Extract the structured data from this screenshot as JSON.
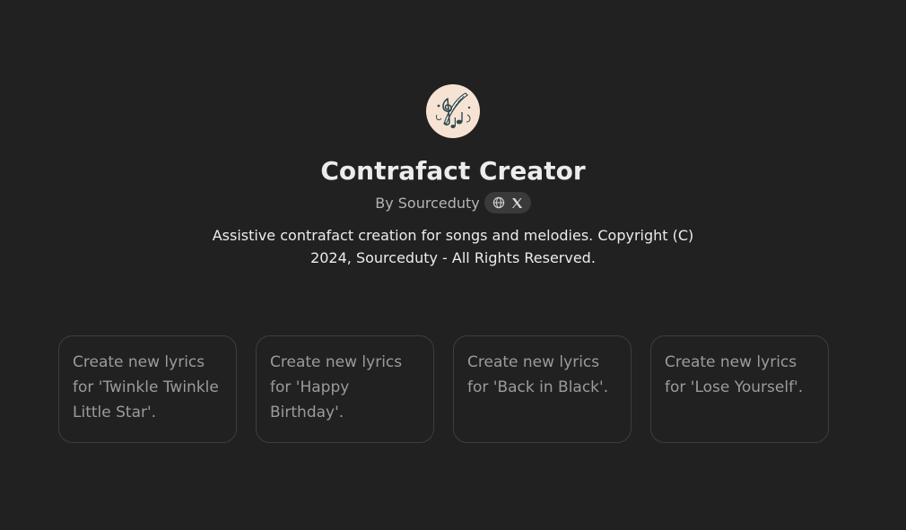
{
  "gpt": {
    "name": "Contrafact Creator",
    "author_label": "By Sourceduty",
    "description": "Assistive contrafact creation for songs and melodies. Copyright (C) 2024, Sourceduty - All Rights Reserved.",
    "avatar_icon": "music-notes-quill-icon",
    "social_icons": [
      "globe-icon",
      "x-logo-icon"
    ]
  },
  "prompts": [
    "Create new lyrics for 'Twinkle Twinkle Little Star'.",
    "Create new lyrics for 'Happy Birthday'.",
    "Create new lyrics for 'Back in Black'.",
    "Create new lyrics for 'Lose Yourself'."
  ],
  "colors": {
    "background": "#212121",
    "title": "#ececec",
    "muted": "#b4b4b4",
    "card_text": "#9b9b9b",
    "card_border": "#3e3e3e",
    "avatar_bg": "#f6e3d3"
  }
}
